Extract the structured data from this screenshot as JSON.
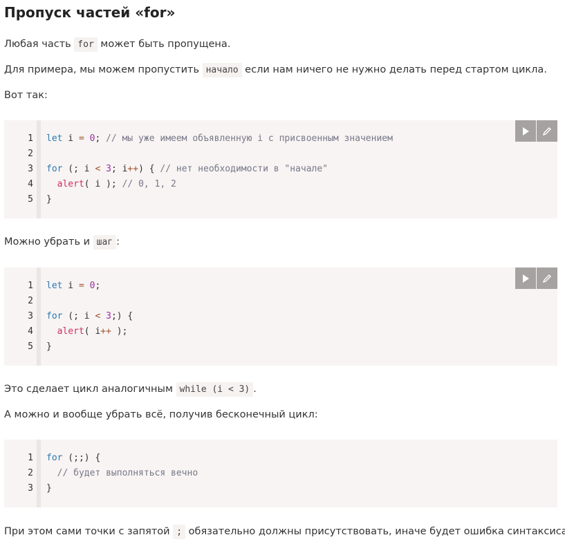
{
  "heading": "Пропуск частей «for»",
  "p1": {
    "before": "Любая часть ",
    "code": "for",
    "after": " может быть пропущена."
  },
  "p2": {
    "before": "Для примера, мы можем пропустить ",
    "code": "начало",
    "after": " если нам ничего не нужно делать перед стартом цикла."
  },
  "p3": "Вот так:",
  "code1": {
    "line_numbers": [
      "1",
      "2",
      "3",
      "4",
      "5"
    ],
    "lines": [
      {
        "kw1": "let",
        "t1": " i ",
        "op1": "=",
        "t2": " ",
        "num1": "0",
        "t3": "; ",
        "cm1": "// мы уже имеем объявленную i с присвоенным значением"
      },
      {},
      {
        "kw1": "for",
        "t1": " (; i ",
        "op1": "<",
        "t2": " ",
        "num1": "3",
        "t3": "; i",
        "op2": "++",
        "t4": ") { ",
        "cm1": "// нет необходимости в \"начале\""
      },
      {
        "t0": "  ",
        "fn1": "alert",
        "t1": "( i ); ",
        "cm1": "// 0, 1, 2"
      },
      {
        "t1": "}"
      }
    ]
  },
  "p4": {
    "before": "Можно убрать и ",
    "code": "шаг",
    "after": ":"
  },
  "code2": {
    "line_numbers": [
      "1",
      "2",
      "3",
      "4",
      "5"
    ],
    "lines": [
      {
        "kw1": "let",
        "t1": " i ",
        "op1": "=",
        "t2": " ",
        "num1": "0",
        "t3": ";"
      },
      {},
      {
        "kw1": "for",
        "t1": " (; i ",
        "op1": "<",
        "t2": " ",
        "num1": "3",
        "t3": ";) {"
      },
      {
        "t0": "  ",
        "fn1": "alert",
        "t1": "( i",
        "op1": "++",
        "t2": " );"
      },
      {
        "t1": "}"
      }
    ]
  },
  "p5": {
    "before": "Это сделает цикл аналогичным ",
    "code": "while (i < 3)",
    "after": "."
  },
  "p6": "А можно и вообще убрать всё, получив бесконечный цикл:",
  "code3": {
    "line_numbers": [
      "1",
      "2",
      "3"
    ],
    "lines": [
      {
        "kw1": "for",
        "t1": " (;;) {"
      },
      {
        "t0": "  ",
        "cm1": "// будет выполняться вечно"
      },
      {
        "t1": "}"
      }
    ]
  },
  "p7": {
    "before": "При этом сами точки с запятой ",
    "code": ";",
    "after": " обязательно должны присутствовать, иначе будет ошибка синтаксиса."
  },
  "icons": {
    "run": "play-icon",
    "edit": "pencil-icon"
  },
  "colors": {
    "keyword": "#2d78b0",
    "function": "#d03060",
    "number": "#9a2fa0",
    "comment": "#777788",
    "toolbar": "#a5a2a1"
  }
}
